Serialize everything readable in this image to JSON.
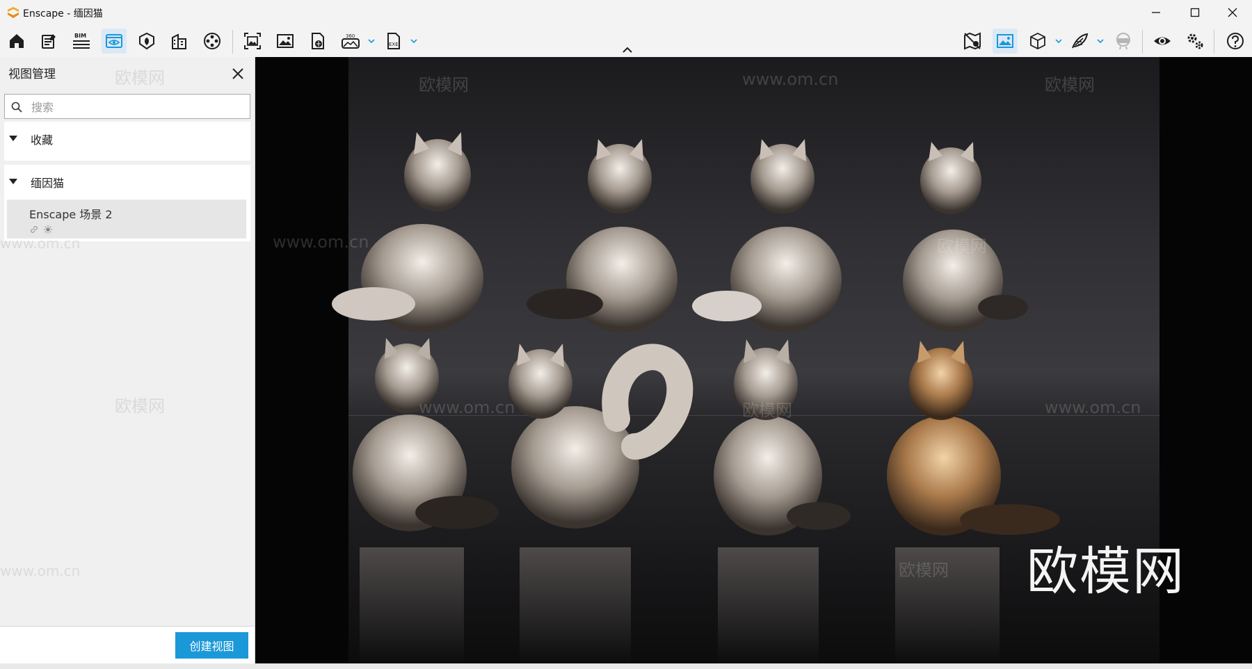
{
  "window": {
    "title": "Enscape - 缅因猫",
    "controls": [
      "minimize-icon",
      "maximize-icon",
      "close-icon"
    ]
  },
  "toolbar": {
    "left_tools": [
      "home-icon",
      "notes-icon",
      "bim-icon",
      "view-management-icon",
      "asset-library-icon",
      "building-icon",
      "video-editor-icon",
      "render-screenshot-icon",
      "render-image-icon",
      "export-web-icon",
      "export-360-icon",
      "export-exe-icon"
    ],
    "bim_label": "BIM",
    "pano_label": "360",
    "exe_label": "EXE",
    "active_tool": "view-management-icon",
    "right_tools": [
      "map-off-icon",
      "image-view-icon",
      "cube-icon",
      "feather-icon",
      "vr-headset-icon",
      "eye-icon",
      "settings-icon",
      "help-icon"
    ],
    "accent": "#1b98d8"
  },
  "panel": {
    "title": "视图管理",
    "search_placeholder": "搜索",
    "groups": [
      {
        "label": "收藏",
        "items": []
      },
      {
        "label": "缅因猫",
        "items": [
          {
            "name": "Enscape 场景 2",
            "icons": [
              "link-icon",
              "sun-icon"
            ]
          }
        ]
      }
    ],
    "create_button": "创建视图"
  },
  "viewport": {
    "scene": "eight maine coon cats on dark studio backdrop",
    "watermarks": [
      "欧模网",
      "www.om.cn",
      "欧模网",
      "www.om.cn",
      "欧模网",
      "www.om.cn",
      "欧模网",
      "www.om.cn",
      "欧模网",
      "www.om.cn",
      "欧模网",
      "www.om.cn",
      "欧模网"
    ],
    "brand_mark": "欧模网"
  }
}
